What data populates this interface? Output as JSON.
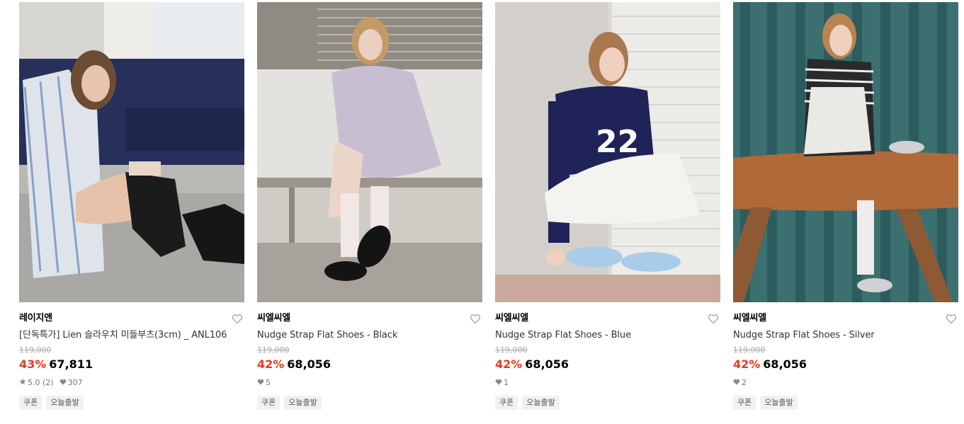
{
  "products": [
    {
      "brand": "레이지앤",
      "title": "[단독특가] Lien 슬라우치 미들부츠(3cm) _ ANL106",
      "original_price": "119,000",
      "discount": "43%",
      "price": "67,811",
      "rating": "5.0",
      "review_count": "(2)",
      "likes": "307",
      "tags": [
        "쿠폰",
        "오늘출발"
      ],
      "icons": {
        "wishlist": "heart-outline-icon",
        "rating": "star-icon",
        "likes": "heart-filled-icon"
      }
    },
    {
      "brand": "씨엘씨엘",
      "title": "Nudge Strap Flat Shoes - Black",
      "original_price": "119,000",
      "discount": "42%",
      "price": "68,056",
      "likes": "5",
      "tags": [
        "쿠폰",
        "오늘출발"
      ],
      "icons": {
        "wishlist": "heart-outline-icon",
        "likes": "heart-filled-icon"
      }
    },
    {
      "brand": "씨엘씨엘",
      "title": "Nudge Strap Flat Shoes - Blue",
      "original_price": "119,000",
      "discount": "42%",
      "price": "68,056",
      "likes": "1",
      "tags": [
        "쿠폰",
        "오늘출발"
      ],
      "icons": {
        "wishlist": "heart-outline-icon",
        "likes": "heart-filled-icon"
      }
    },
    {
      "brand": "씨엘씨엘",
      "title": "Nudge Strap Flat Shoes - Silver",
      "original_price": "119,000",
      "discount": "42%",
      "price": "68,056",
      "likes": "2",
      "tags": [
        "쿠폰",
        "오늘출발"
      ],
      "icons": {
        "wishlist": "heart-outline-icon",
        "likes": "heart-filled-icon"
      }
    }
  ],
  "colors": {
    "discount": "#f1361d",
    "original_price": "#a8a8a8",
    "tag_background": "#f1f1f1",
    "stats_text": "#777777"
  }
}
